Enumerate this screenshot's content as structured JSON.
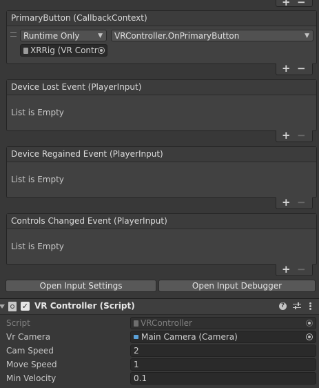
{
  "top_footer": {
    "plus": "+",
    "minus": "−"
  },
  "primary_button_event": {
    "header": "PrimaryButton (CallbackContext)",
    "runtime_dropdown": "Runtime Only",
    "function_dropdown": "VRController.OnPrimaryButton",
    "object_field": "XRRig (VR Contr",
    "plus": "+",
    "minus": "−"
  },
  "device_lost_event": {
    "header": "Device Lost Event (PlayerInput)",
    "empty": "List is Empty",
    "plus": "+",
    "minus": "−"
  },
  "device_regained_event": {
    "header": "Device Regained Event (PlayerInput)",
    "empty": "List is Empty",
    "plus": "+",
    "minus": "−"
  },
  "controls_changed_event": {
    "header": "Controls Changed Event (PlayerInput)",
    "empty": "List is Empty",
    "plus": "+",
    "minus": "−"
  },
  "buttons": {
    "open_input_settings": "Open Input Settings",
    "open_input_debugger": "Open Input Debugger"
  },
  "component": {
    "title": "VR Controller (Script)",
    "help_glyph": "?",
    "properties": [
      {
        "label": "Script",
        "value": "VRController"
      },
      {
        "label": "Vr Camera",
        "value": "Main Camera (Camera)"
      },
      {
        "label": "Cam Speed",
        "value": "2"
      },
      {
        "label": "Move Speed",
        "value": "1"
      },
      {
        "label": "Min Velocity",
        "value": "0.1"
      }
    ]
  }
}
